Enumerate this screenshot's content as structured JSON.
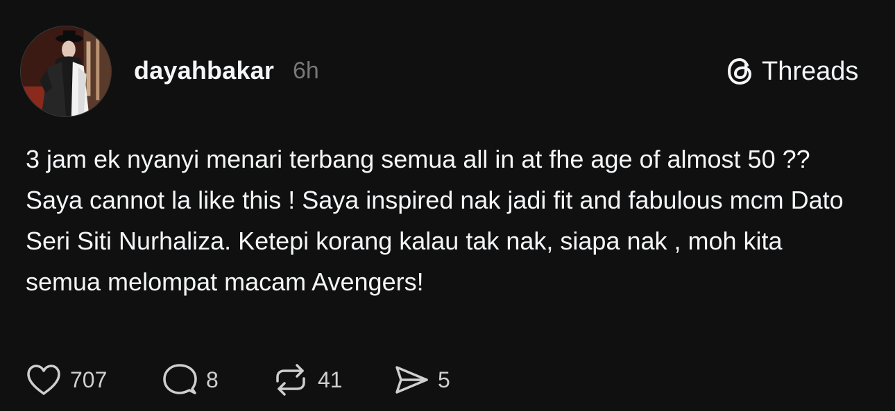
{
  "post": {
    "username": "dayahbakar",
    "timestamp": "6h",
    "brand": "Threads",
    "paragraphs": [
      "3 jam ek nyanyi menari terbang semua all in at fhe age of almost 50 ??",
      "Saya cannot la like this ! Saya inspired nak jadi fit and fabulous mcm Dato Seri Siti Nurhaliza. Ketepi korang kalau tak nak, siapa nak , moh kita semua melompat macam Avengers!"
    ],
    "stats": {
      "likes": "707",
      "replies": "8",
      "reposts": "41",
      "shares": "5"
    }
  },
  "icons": {
    "brand": "threads-logo-icon",
    "like": "heart-icon",
    "reply": "speech-bubble-icon",
    "repost": "repost-arrows-icon",
    "share": "paper-plane-icon"
  },
  "colors": {
    "background": "#101010",
    "text": "#f3f5f7",
    "muted": "#777777"
  }
}
